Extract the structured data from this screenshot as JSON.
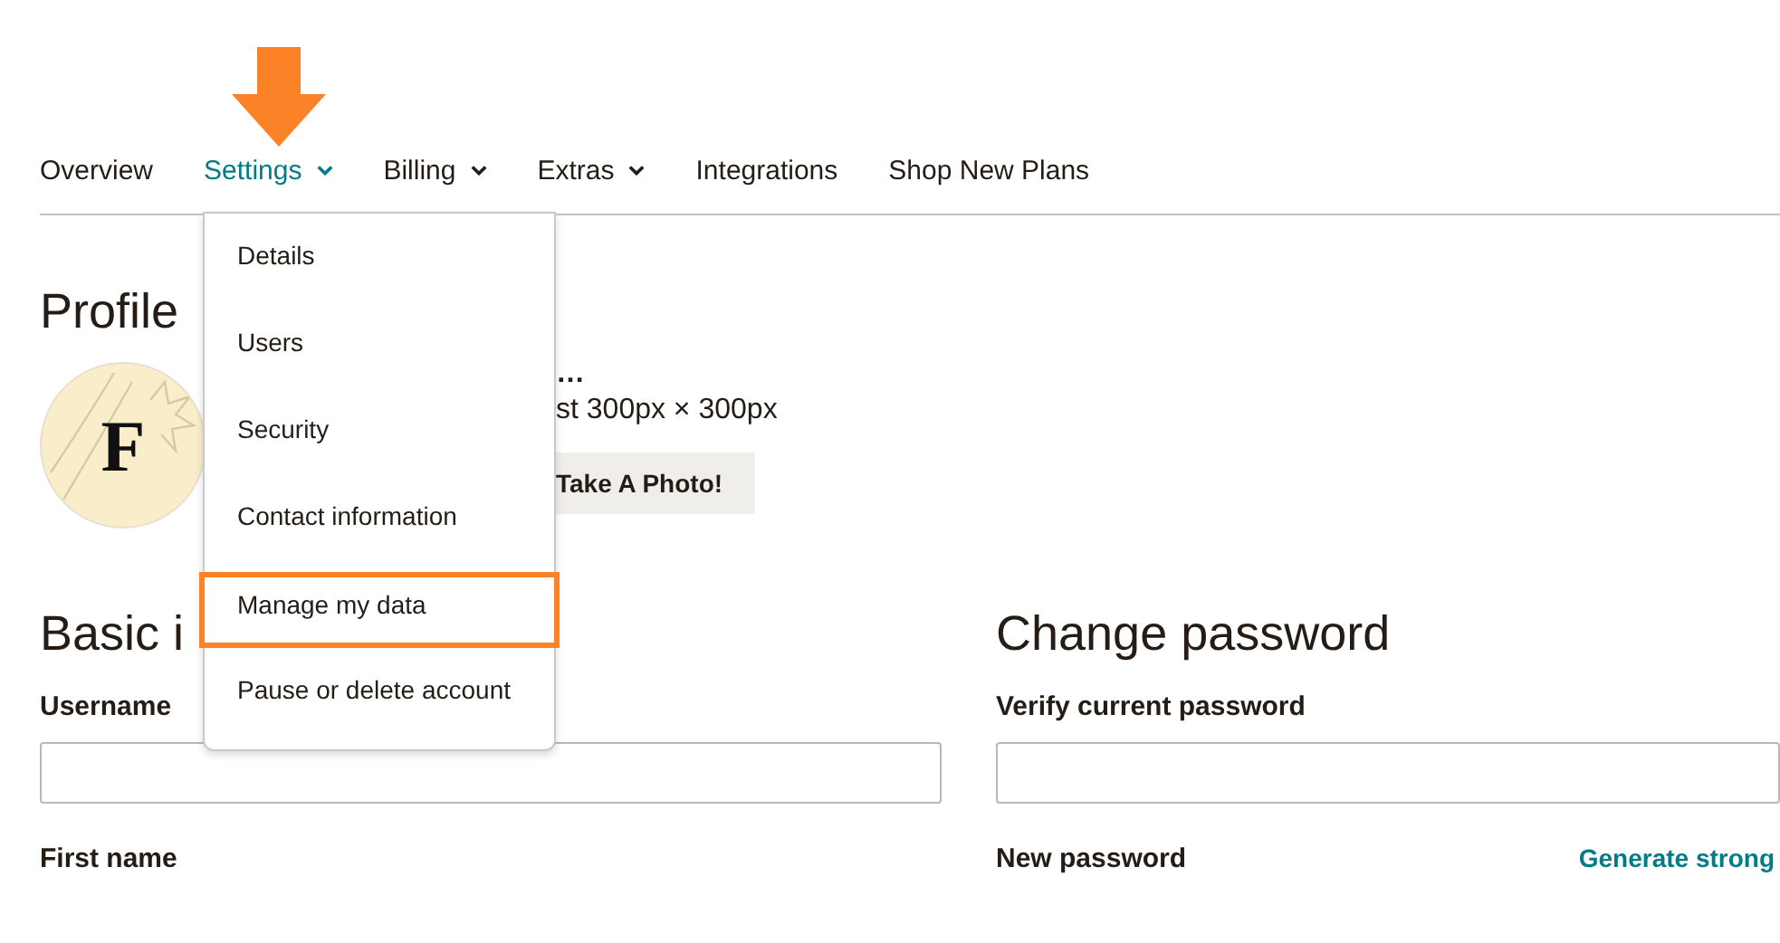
{
  "nav": [
    {
      "label": "Overview",
      "selected": false,
      "dropdown": false
    },
    {
      "label": "Settings",
      "selected": true,
      "dropdown": true
    },
    {
      "label": "Billing",
      "selected": false,
      "dropdown": true
    },
    {
      "label": "Extras",
      "selected": false,
      "dropdown": true
    },
    {
      "label": "Integrations",
      "selected": false,
      "dropdown": false
    },
    {
      "label": "Shop New Plans",
      "selected": false,
      "dropdown": false
    }
  ],
  "settings_menu": [
    {
      "label": "Details",
      "highlighted": false
    },
    {
      "label": "Users",
      "highlighted": false
    },
    {
      "label": "Security",
      "highlighted": false
    },
    {
      "label": "Contact information",
      "highlighted": false
    },
    {
      "label": "Manage my data",
      "highlighted": true
    },
    {
      "label": "Pause or delete account",
      "highlighted": false
    }
  ],
  "profile": {
    "heading": "Profile",
    "avatar_initial": "F",
    "title_fragment": "…",
    "hint": "st 300px × 300px",
    "button": "Take A Photo!"
  },
  "basic_info": {
    "heading": "Basic i",
    "fields": [
      {
        "label": "Username",
        "input": true
      },
      {
        "label": "First name",
        "input": false
      }
    ]
  },
  "change_password": {
    "heading": "Change password",
    "fields": [
      {
        "label": "Verify current password",
        "input": true
      },
      {
        "label": "New password",
        "input": false,
        "link": "Generate strong"
      }
    ]
  }
}
